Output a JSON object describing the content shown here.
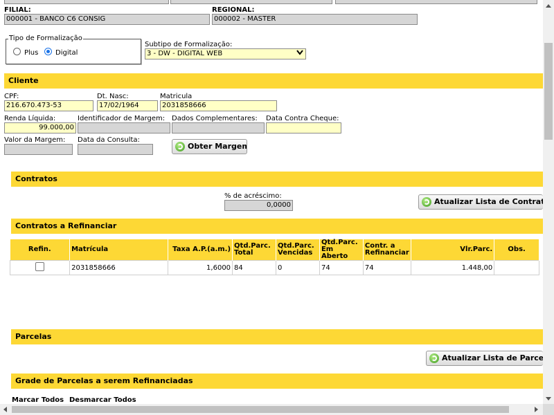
{
  "header": {
    "filial_label": "FILIAL:",
    "filial_value": "000001 - BANCO C6 CONSIG",
    "regional_label": "REGIONAL:",
    "regional_value": "000002 - MASTER"
  },
  "formalizacao": {
    "legend": "Tipo de Formalização",
    "option_plus": "Plus",
    "option_digital": "Digital",
    "selected": "Digital",
    "subtipo_label": "Subtipo de Formalização:",
    "subtipo_value": "3 - DW - DIGITAL WEB"
  },
  "cliente": {
    "section_title": "Cliente",
    "cpf_label": "CPF:",
    "cpf_value": "216.670.473-53",
    "nasc_label": "Dt. Nasc:",
    "nasc_value": "17/02/1964",
    "matricula_label": "Matricula",
    "matricula_value": "2031858666",
    "renda_label": "Renda Líquida:",
    "renda_value": "99.000,00",
    "ident_margem_label": "Identificador de Margem:",
    "ident_margem_value": "",
    "dados_comp_label": "Dados Complementares:",
    "dados_comp_value": "",
    "data_cheque_label": "Data Contra Cheque:",
    "data_cheque_value": "",
    "valor_margem_label": "Valor da Margem:",
    "valor_margem_value": "",
    "data_consulta_label": "Data da Consulta:",
    "data_consulta_value": "",
    "obter_margem_button": "Obter Margem"
  },
  "contratos": {
    "section_title": "Contratos",
    "acrescimo_label": "% de acréscimo:",
    "acrescimo_value": "0,0000",
    "atualizar_button": "Atualizar Lista de Contratos"
  },
  "refinanciar": {
    "section_title": "Contratos a Refinanciar",
    "columns": [
      "Refin.",
      "Matrícula",
      "Taxa A.P.(a.m.)",
      "Qtd.Parc. Total",
      "Qtd.Parc. Vencidas",
      "Qtd.Parc. Em Aberto",
      "Contr. a Refinanciar",
      "Vlr.Parc.",
      "Obs."
    ],
    "rows": [
      {
        "refin": false,
        "matricula": "2031858666",
        "taxa": "1,6000",
        "total": "84",
        "vencidas": "0",
        "aberto": "74",
        "contr": "74",
        "vlr": "1.448,00",
        "obs": ""
      }
    ]
  },
  "parcelas": {
    "section_title": "Parcelas",
    "atualizar_button": "Atualizar Lista de Parcelas"
  },
  "grade": {
    "section_title": "Grade de Parcelas a serem Refinanciadas",
    "marcar_todos": "Marcar Todos",
    "desmarcar_todos": "Desmarcar Todos"
  },
  "colors": {
    "section_bar": "#fdd835",
    "input_yellow": "#ffffc6",
    "input_gray": "#d6d6d6"
  }
}
